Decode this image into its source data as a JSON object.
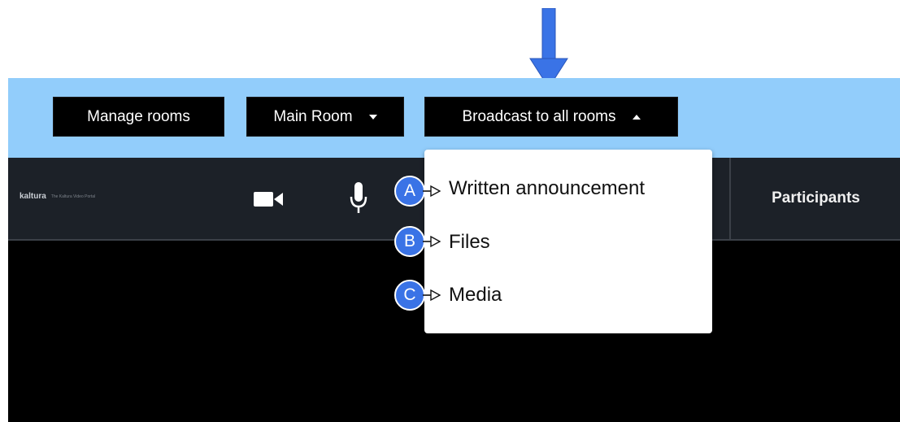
{
  "top_bar": {
    "manage_rooms_label": "Manage rooms",
    "main_room_label": "Main Room",
    "broadcast_label": "Broadcast to all rooms"
  },
  "toolbar": {
    "logo_brand": "kaltura",
    "logo_tagline": "The Kaltura Video Portal",
    "camera_icon": "video-camera-icon",
    "mic_icon": "microphone-icon",
    "participants_label": "Participants"
  },
  "broadcast_menu": {
    "items": [
      {
        "label": "Written announcement",
        "callout": "A"
      },
      {
        "label": "Files",
        "callout": "B"
      },
      {
        "label": "Media",
        "callout": "C"
      }
    ]
  },
  "colors": {
    "top_bar": "#92cdfb",
    "toolbar": "#1c2128",
    "stage": "#000000",
    "callout": "#3a73e6",
    "indicator_arrow": "#3a73e6"
  }
}
